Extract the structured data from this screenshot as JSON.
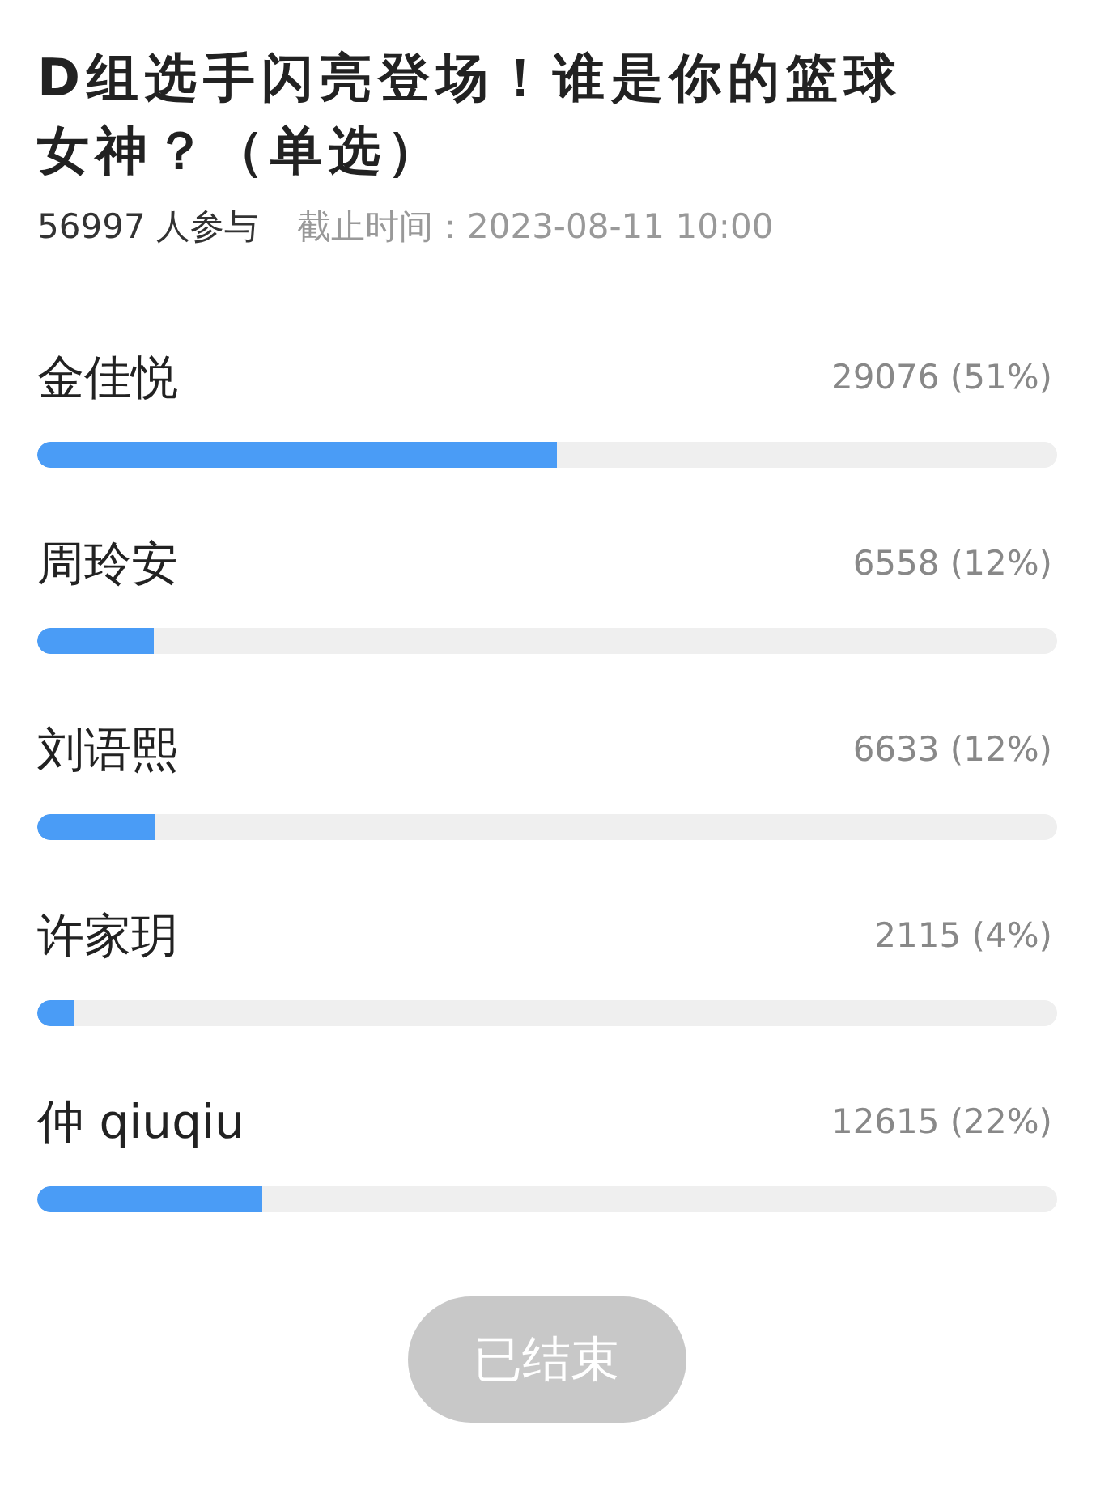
{
  "poll": {
    "title": "D组选手闪亮登场！谁是你的篮球女神？（单选）",
    "participants": "56997 人参与",
    "deadline": "截止时间：2023-08-11 10:00"
  },
  "options": [
    {
      "name": "金佳悦",
      "votes": "29076 (51%)",
      "level": 0.51
    },
    {
      "name": "周玲安",
      "votes": "6558 (12%)",
      "level": 0.115
    },
    {
      "name": "刘语熙",
      "votes": "6633 (12%)",
      "level": 0.116
    },
    {
      "name": "许家玥",
      "votes": "2115 (4%)",
      "level": 0.037
    },
    {
      "name": "仲 qiuqiu",
      "votes": "12615 (22%)",
      "level": 0.221
    }
  ],
  "button": {
    "label": "已结束",
    "disabled": true
  }
}
